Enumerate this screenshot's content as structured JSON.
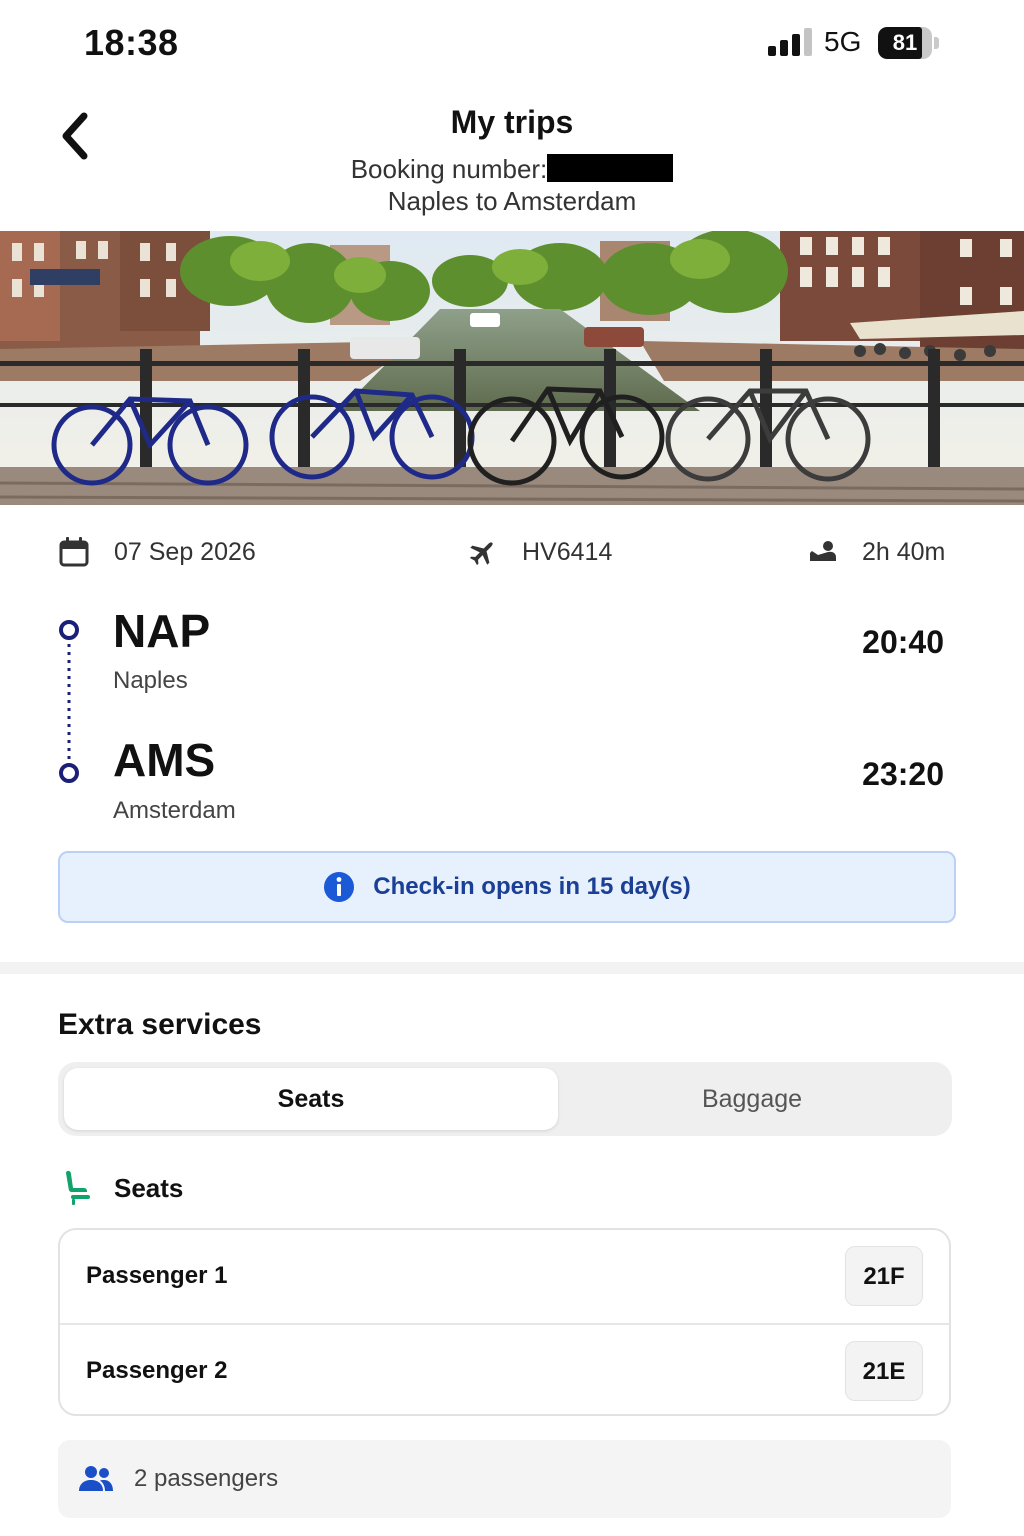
{
  "status_bar": {
    "time": "18:38",
    "network": "5G",
    "battery_level": "81",
    "battery_fraction": 0.81
  },
  "header": {
    "title": "My trips",
    "booking_label": "Booking number:",
    "route": "Naples to Amsterdam"
  },
  "flight": {
    "date": "07 Sep 2026",
    "flight_number": "HV6414",
    "duration": "2h 40m",
    "departure": {
      "code": "NAP",
      "city": "Naples",
      "time": "20:40"
    },
    "arrival": {
      "code": "AMS",
      "city": "Amsterdam",
      "time": "23:20"
    }
  },
  "checkin_notice": "Check-in opens in 15 day(s)",
  "extra_services": {
    "title": "Extra services",
    "tabs": [
      {
        "label": "Seats",
        "active": true
      },
      {
        "label": "Baggage",
        "active": false
      }
    ],
    "seats_heading": "Seats",
    "passengers": [
      {
        "name": "Passenger 1",
        "seat": "21F"
      },
      {
        "name": "Passenger 2",
        "seat": "21E"
      }
    ],
    "passenger_count": "2 passengers"
  },
  "colors": {
    "accent_navy": "#1c1f78",
    "info_blue": "#1b5ad6",
    "notice_bg": "#e7f0fd",
    "seat_green": "#10a36a"
  }
}
